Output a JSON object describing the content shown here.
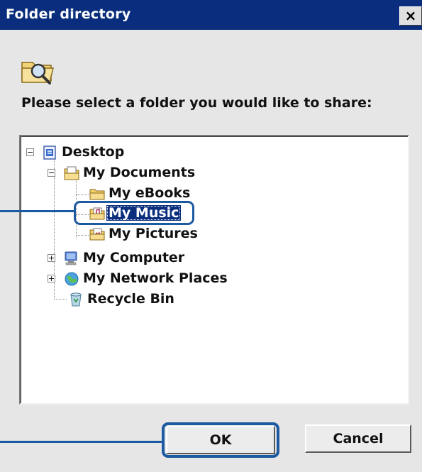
{
  "window": {
    "title": "Folder directory",
    "close_glyph": "×"
  },
  "prompt": "Please select a folder you would like to share:",
  "tree": {
    "desktop": {
      "label": "Desktop",
      "icon": "desktop-icon",
      "expander": "−"
    },
    "my_documents": {
      "label": "My Documents",
      "icon": "documents-folder-icon",
      "expander": "−"
    },
    "my_ebooks": {
      "label": "My eBooks",
      "icon": "folder-icon"
    },
    "my_music": {
      "label": "My Music",
      "icon": "music-folder-icon",
      "selected": true
    },
    "my_pictures": {
      "label": "My Pictures",
      "icon": "pictures-folder-icon"
    },
    "my_computer": {
      "label": "My Computer",
      "icon": "computer-icon",
      "expander": "+"
    },
    "my_network_places": {
      "label": "My Network Places",
      "icon": "network-icon",
      "expander": "+"
    },
    "recycle_bin": {
      "label": "Recycle Bin",
      "icon": "recycle-bin-icon"
    }
  },
  "buttons": {
    "ok": "OK",
    "cancel": "Cancel"
  },
  "colors": {
    "titlebar": "#0a2e7d",
    "callout": "#1e5aa0",
    "dialog_bg": "#e6e6e6"
  }
}
